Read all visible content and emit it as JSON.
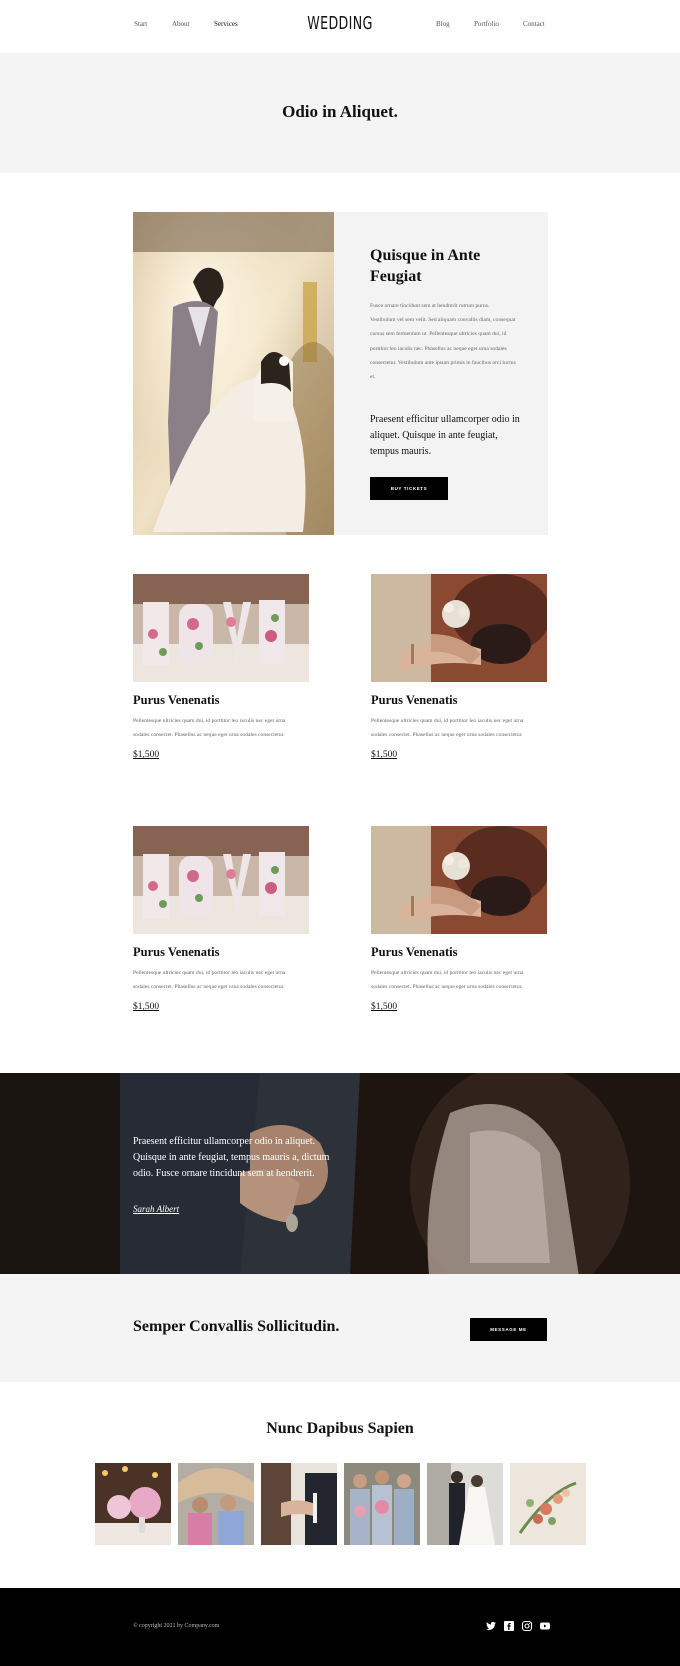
{
  "nav": {
    "left": [
      "Start",
      "About",
      "Services"
    ],
    "right": [
      "Blog",
      "Portfolio",
      "Contact"
    ],
    "active": "Services",
    "logo": "WEDDING"
  },
  "hero": {
    "title": "Odio in Aliquet."
  },
  "feature": {
    "title": "Quisque in Ante Feugiat",
    "body": "Fusce ornare tincidunt sem at hendrerit rutrum purus. Vestibulum vel sem velit. Sed aliquam convallis diam, consequat cursus sem fermentum ut. Pellentesque ultricies quam dui, id porttitor leo iaculis nec. Phasellus ac neque eget urna sodales consectetur. Vestibulum ante ipsum primis in faucibus orci luctus et.",
    "highlight": "Praesent efficitur ullamcorper odio in aliquet. Quisque in ante feugiat, tempus mauris.",
    "button": "BUY TICKETS"
  },
  "cards": [
    {
      "image": "love-letters",
      "title": "Purus Venenatis",
      "text": "Pellentesque ultricies quam dui, id porttitor leo iaculis nec eget urna sodales consectet. Phasellus ac neque eget urna sodales consectetur.",
      "price": "$1,500"
    },
    {
      "image": "bouquet-hands",
      "title": "Purus Venenatis",
      "text": "Pellentesque ultricies quam dui, id porttitor leo iaculis nec eget urna sodales consectet. Phasellus ac neque eget urna sodales consectetur.",
      "price": "$1,500"
    },
    {
      "image": "love-letters",
      "title": "Purus Venenatis",
      "text": "Pellentesque ultricies quam dui, id porttitor leo iaculis nec eget urna sodales consectet. Phasellus ac neque eget urna sodales consectetur.",
      "price": "$1,500"
    },
    {
      "image": "bouquet-hands",
      "title": "Purus Venenatis",
      "text": "Pellentesque ultricies quam dui, id porttitor leo iaculis nec eget urna sodales consectet. Phasellus ac neque eget urna sodales consectetur.",
      "price": "$1,500"
    }
  ],
  "quote": {
    "text": "Praesent efficitur ullamcorper odio in aliquet. Quisque in ante feugiat, tempus mauris a, dictum odio. Fusce ornare tincidunt sem at hendrerit.",
    "author": "Sarah Albert"
  },
  "cta": {
    "title": "Semper Convallis Sollicitudin.",
    "button": "MESSAGE ME"
  },
  "gallery": {
    "title": "Nunc Dapibus Sapien",
    "items": [
      "table-flowers",
      "guests-arch",
      "ring-exchange",
      "bridesmaids",
      "couple-walking",
      "bouquet"
    ]
  },
  "footer": {
    "copyright": "© copyright 2021 by Company.com",
    "social": [
      "twitter-icon",
      "facebook-icon",
      "instagram-icon",
      "youtube-icon"
    ]
  }
}
